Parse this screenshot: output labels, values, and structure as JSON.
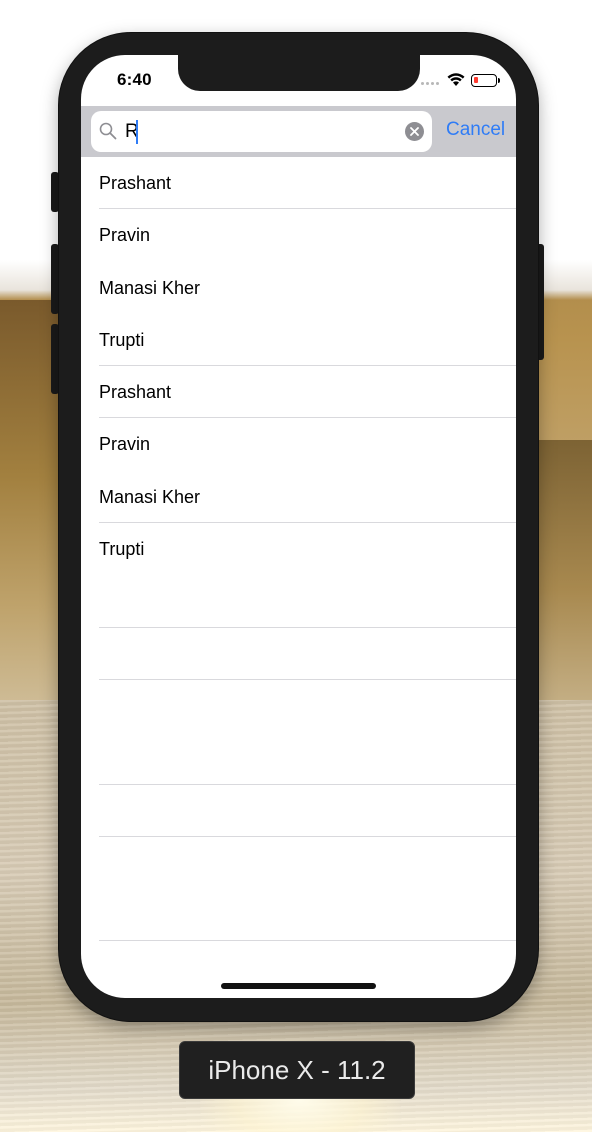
{
  "status_bar": {
    "time": "6:40"
  },
  "search": {
    "query": "R",
    "cancel_label": "Cancel"
  },
  "results": [
    {
      "label": "Prashant"
    },
    {
      "label": "Pravin"
    },
    {
      "label": "Manasi Kher"
    },
    {
      "label": "Trupti"
    },
    {
      "label": "Prashant"
    },
    {
      "label": "Pravin"
    },
    {
      "label": "Manasi Kher"
    },
    {
      "label": "Trupti"
    }
  ],
  "simulator": {
    "device_label": "iPhone X - 11.2"
  },
  "colors": {
    "accent": "#2f7cf6",
    "search_bar_bg": "#c9c9ce",
    "separator": "#d9d9dd",
    "battery_low": "#ff3b30"
  },
  "icons": [
    "search-icon",
    "clear-text-icon",
    "wifi-icon",
    "battery-icon",
    "cellular-signal-icon"
  ]
}
